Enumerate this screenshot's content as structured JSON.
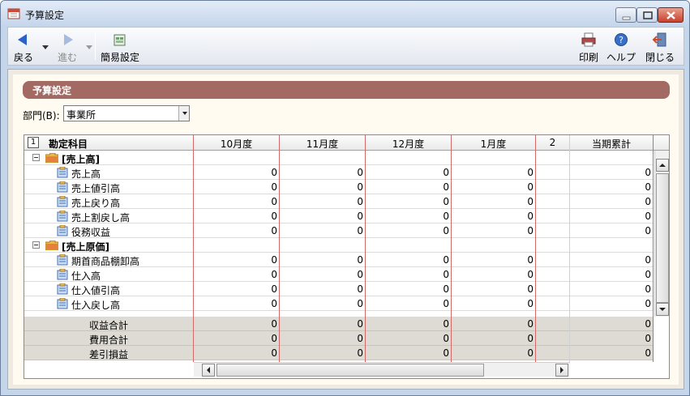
{
  "window": {
    "title": "予算設定"
  },
  "toolbar": {
    "back_label": "戻る",
    "forward_label": "進む",
    "simple_label": "簡易設定",
    "print_label": "印刷",
    "help_label": "ヘルプ",
    "close_label": "閉じる"
  },
  "section": {
    "title": "予算設定"
  },
  "department": {
    "label": "部門(B):",
    "value": "事業所"
  },
  "grid": {
    "corner_number": "1",
    "account_header": "勘定科目",
    "months": [
      "10月度",
      "11月度",
      "12月度",
      "1月度"
    ],
    "cumulative_header": "当期累計",
    "rows": [
      {
        "type": "group",
        "label": "[売上高]",
        "values": [
          "",
          "",
          "",
          ""
        ],
        "total": ""
      },
      {
        "type": "item",
        "label": "売上高",
        "values": [
          "0",
          "0",
          "0",
          "0"
        ],
        "total": "0"
      },
      {
        "type": "item",
        "label": "売上値引高",
        "values": [
          "0",
          "0",
          "0",
          "0"
        ],
        "total": "0"
      },
      {
        "type": "item",
        "label": "売上戻り高",
        "values": [
          "0",
          "0",
          "0",
          "0"
        ],
        "total": "0"
      },
      {
        "type": "item",
        "label": "売上割戻し高",
        "values": [
          "0",
          "0",
          "0",
          "0"
        ],
        "total": "0"
      },
      {
        "type": "item",
        "label": "役務収益",
        "values": [
          "0",
          "0",
          "0",
          "0"
        ],
        "total": "0"
      },
      {
        "type": "group",
        "label": "[売上原価]",
        "values": [
          "",
          "",
          "",
          ""
        ],
        "total": ""
      },
      {
        "type": "item",
        "label": "期首商品棚卸高",
        "values": [
          "0",
          "0",
          "0",
          "0"
        ],
        "total": "0"
      },
      {
        "type": "item",
        "label": "仕入高",
        "values": [
          "0",
          "0",
          "0",
          "0"
        ],
        "total": "0"
      },
      {
        "type": "item",
        "label": "仕入値引高",
        "values": [
          "0",
          "0",
          "0",
          "0"
        ],
        "total": "0"
      },
      {
        "type": "item",
        "label": "仕入戻し高",
        "values": [
          "0",
          "0",
          "0",
          "0"
        ],
        "total": "0"
      }
    ],
    "totals": [
      {
        "label": "収益合計",
        "values": [
          "0",
          "0",
          "0",
          "0"
        ],
        "total": "0"
      },
      {
        "label": "費用合計",
        "values": [
          "0",
          "0",
          "0",
          "0"
        ],
        "total": "0"
      },
      {
        "label": "差引損益",
        "values": [
          "0",
          "0",
          "0",
          "0"
        ],
        "total": "0"
      }
    ]
  },
  "colors": {
    "section_header": "#a36a64",
    "grid_divider": "#d36a6a",
    "panel_bg": "#fffbf0"
  },
  "icons": [
    "calendar-icon",
    "back-arrow-icon",
    "forward-arrow-icon",
    "simple-setting-icon",
    "printer-icon",
    "help-icon",
    "exit-icon",
    "folder-icon",
    "account-item-icon"
  ]
}
